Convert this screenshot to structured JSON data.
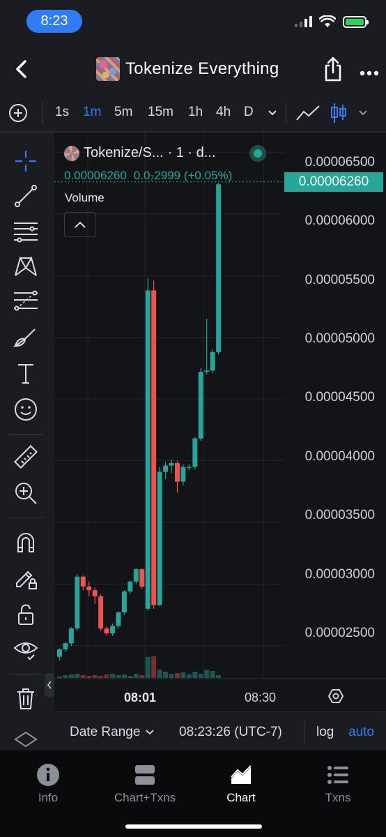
{
  "status": {
    "time": "8:23"
  },
  "header": {
    "title": "Tokenize Everything"
  },
  "toolbar": {
    "add_icon": "plus-circle-icon",
    "timeframes": [
      "1s",
      "1m",
      "5m",
      "15m",
      "1h",
      "4h",
      "D"
    ],
    "active_timeframe": "1m",
    "chart_type_icons": [
      "line-chart-icon",
      "candlestick-icon"
    ]
  },
  "tools": {
    "items": [
      "crosshair-icon",
      "trend-line-icon",
      "horizontal-lines-icon",
      "pattern-icon",
      "fib-icon",
      "brush-icon",
      "text-icon",
      "emoji-icon",
      "ruler-icon",
      "zoom-in-icon",
      "magnet-icon",
      "lock-pencil-icon",
      "unlock-icon",
      "eye-icon",
      "trash-icon",
      "layers-icon"
    ]
  },
  "legend": {
    "symbol": "Tokenize/S...",
    "interval": "· 1 · d...",
    "price": "0.00006260",
    "change": "0.0₇2999 (+0.05%)",
    "volume_label": "Volume"
  },
  "accent": {
    "up": "#26a69a",
    "down": "#ef5350",
    "brand": "#2f7cf6"
  },
  "chart_data": {
    "type": "candlestick",
    "title": "",
    "y_ticks": [
      "0.00006500",
      "0.00006000",
      "0.00005500",
      "0.00005000",
      "0.00004500",
      "0.00004000",
      "0.00003500",
      "0.00003000",
      "0.00002500"
    ],
    "x_ticks": [
      "08:01",
      "08:30"
    ],
    "last_price": "0.00006260",
    "ylim": [
      2.25e-05,
      6.66e-05
    ],
    "candles": [
      {
        "o": 2.41e-05,
        "h": 2.48e-05,
        "l": 2.38e-05,
        "c": 2.47e-05
      },
      {
        "o": 2.47e-05,
        "h": 2.53e-05,
        "l": 2.45e-05,
        "c": 2.52e-05
      },
      {
        "o": 2.52e-05,
        "h": 2.65e-05,
        "l": 2.5e-05,
        "c": 2.64e-05
      },
      {
        "o": 2.64e-05,
        "h": 3.08e-05,
        "l": 2.62e-05,
        "c": 3.06e-05
      },
      {
        "o": 3.06e-05,
        "h": 3.07e-05,
        "l": 2.95e-05,
        "c": 2.98e-05
      },
      {
        "o": 2.98e-05,
        "h": 3.02e-05,
        "l": 2.9e-05,
        "c": 2.95e-05
      },
      {
        "o": 2.95e-05,
        "h": 2.97e-05,
        "l": 2.84e-05,
        "c": 2.9e-05
      },
      {
        "o": 2.9e-05,
        "h": 2.92e-05,
        "l": 2.62e-05,
        "c": 2.64e-05
      },
      {
        "o": 2.64e-05,
        "h": 2.66e-05,
        "l": 2.58e-05,
        "c": 2.6e-05
      },
      {
        "o": 2.6e-05,
        "h": 2.68e-05,
        "l": 2.58e-05,
        "c": 2.66e-05
      },
      {
        "o": 2.66e-05,
        "h": 2.78e-05,
        "l": 2.64e-05,
        "c": 2.77e-05
      },
      {
        "o": 2.77e-05,
        "h": 2.95e-05,
        "l": 2.75e-05,
        "c": 2.94e-05
      },
      {
        "o": 2.94e-05,
        "h": 3.03e-05,
        "l": 2.92e-05,
        "c": 3.02e-05
      },
      {
        "o": 3.02e-05,
        "h": 3.13e-05,
        "l": 3e-05,
        "c": 3.12e-05
      },
      {
        "o": 3.12e-05,
        "h": 3.13e-05,
        "l": 2.96e-05,
        "c": 2.98e-05
      },
      {
        "o": 2.8e-05,
        "h": 5.48e-05,
        "l": 2.78e-05,
        "c": 5.38e-05
      },
      {
        "o": 5.38e-05,
        "h": 5.46e-05,
        "l": 2.8e-05,
        "c": 2.83e-05
      },
      {
        "o": 2.83e-05,
        "h": 3.95e-05,
        "l": 2.82e-05,
        "c": 3.91e-05
      },
      {
        "o": 3.91e-05,
        "h": 3.99e-05,
        "l": 3.85e-05,
        "c": 3.96e-05
      },
      {
        "o": 3.96e-05,
        "h": 4.01e-05,
        "l": 3.9e-05,
        "c": 3.98e-05
      },
      {
        "o": 3.98e-05,
        "h": 4e-05,
        "l": 3.74e-05,
        "c": 3.83e-05
      },
      {
        "o": 3.83e-05,
        "h": 3.97e-05,
        "l": 3.8e-05,
        "c": 3.95e-05
      },
      {
        "o": 3.95e-05,
        "h": 3.97e-05,
        "l": 3.92e-05,
        "c": 3.95e-05
      },
      {
        "o": 3.95e-05,
        "h": 4.19e-05,
        "l": 3.93e-05,
        "c": 4.18e-05
      },
      {
        "o": 4.18e-05,
        "h": 4.75e-05,
        "l": 4.16e-05,
        "c": 4.72e-05
      },
      {
        "o": 4.72e-05,
        "h": 5.15e-05,
        "l": 4.7e-05,
        "c": 4.73e-05
      },
      {
        "o": 4.73e-05,
        "h": 4.9e-05,
        "l": 4.71e-05,
        "c": 4.88e-05
      },
      {
        "o": 4.88e-05,
        "h": 6.25e-05,
        "l": 4.86e-05,
        "c": 6.24e-05
      }
    ],
    "volume": [
      2,
      4,
      5,
      6,
      4,
      3,
      4,
      3,
      5,
      6,
      4,
      5,
      3,
      6,
      4,
      30,
      31,
      12,
      9,
      6,
      7,
      8,
      5,
      9,
      6,
      12,
      10,
      4
    ],
    "volume_max": 40
  },
  "datebar": {
    "range_label": "Date Range",
    "clock": "08:23:26 (UTC-7)",
    "log": "log",
    "auto": "auto"
  },
  "tabs": [
    {
      "label": "Info",
      "icon": "info-icon"
    },
    {
      "label": "Chart+Txns",
      "icon": "split-view-icon"
    },
    {
      "label": "Chart",
      "icon": "area-chart-icon"
    },
    {
      "label": "Txns",
      "icon": "list-icon"
    }
  ]
}
